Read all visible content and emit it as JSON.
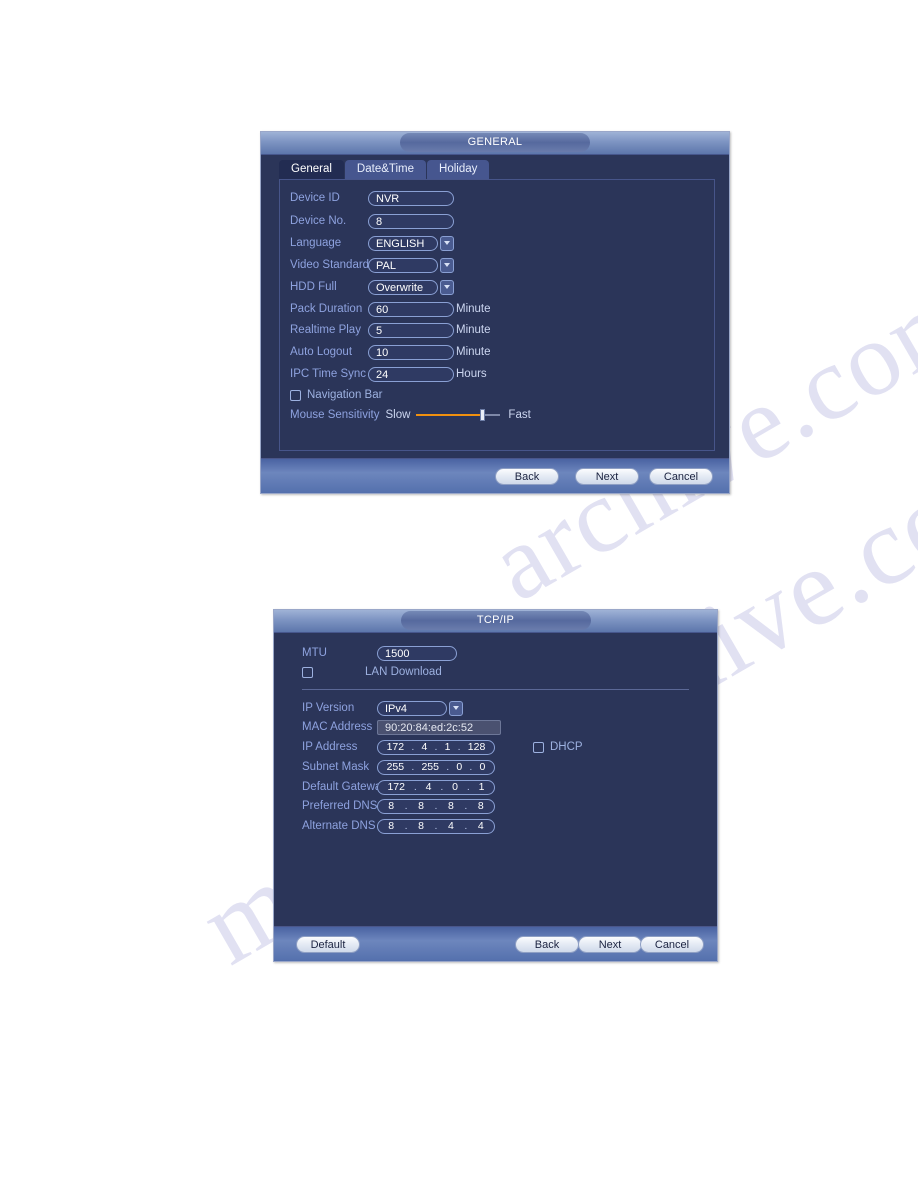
{
  "watermark": {
    "line1": "manualsarchive.com",
    "line2": "archive.com"
  },
  "general_dialog": {
    "title": "GENERAL",
    "tabs": [
      {
        "label": "General",
        "active": true
      },
      {
        "label": "Date&Time",
        "active": false
      },
      {
        "label": "Holiday",
        "active": false
      }
    ],
    "fields": {
      "device_id": {
        "label": "Device ID",
        "value": "NVR"
      },
      "device_no": {
        "label": "Device No.",
        "value": "8"
      },
      "language": {
        "label": "Language",
        "value": "ENGLISH"
      },
      "video_standard": {
        "label": "Video Standard",
        "value": "PAL"
      },
      "hdd_full": {
        "label": "HDD Full",
        "value": "Overwrite"
      },
      "pack_duration": {
        "label": "Pack Duration",
        "value": "60",
        "unit": "Minute"
      },
      "realtime_play": {
        "label": "Realtime Play",
        "value": "5",
        "unit": "Minute"
      },
      "auto_logout": {
        "label": "Auto Logout",
        "value": "10",
        "unit": "Minute"
      },
      "ipc_time_sync": {
        "label": "IPC Time Sync",
        "value": "24",
        "unit": "Hours"
      },
      "navigation_bar": {
        "label": "Navigation Bar",
        "checked": false
      },
      "mouse_sensitivity": {
        "label": "Mouse Sensitivity",
        "min_label": "Slow",
        "max_label": "Fast",
        "percent": 78
      }
    },
    "buttons": {
      "back": "Back",
      "next": "Next",
      "cancel": "Cancel"
    }
  },
  "tcpip_dialog": {
    "title": "TCP/IP",
    "fields": {
      "mtu": {
        "label": "MTU",
        "value": "1500"
      },
      "lan_download": {
        "label": "LAN Download",
        "checked": false
      },
      "ip_version": {
        "label": "IP Version",
        "value": "IPv4"
      },
      "mac_address": {
        "label": "MAC Address",
        "value": "90:20:84:ed:2c:52"
      },
      "ip_address": {
        "label": "IP Address",
        "octets": [
          "172",
          "4",
          "1",
          "128"
        ]
      },
      "subnet_mask": {
        "label": "Subnet Mask",
        "octets": [
          "255",
          "255",
          "0",
          "0"
        ]
      },
      "default_gateway": {
        "label": "Default Gateway",
        "octets": [
          "172",
          "4",
          "0",
          "1"
        ]
      },
      "preferred_dns": {
        "label": "Preferred DNS",
        "octets": [
          "8",
          "8",
          "8",
          "8"
        ]
      },
      "alternate_dns": {
        "label": "Alternate DNS",
        "octets": [
          "8",
          "8",
          "4",
          "4"
        ]
      },
      "dhcp": {
        "label": "DHCP",
        "checked": false
      }
    },
    "buttons": {
      "default": "Default",
      "back": "Back",
      "next": "Next",
      "cancel": "Cancel"
    }
  },
  "colors": {
    "dialog_bg": "#2b3559",
    "label_blue": "#8ea2df",
    "accent_orange": "#f0900f",
    "title_bar": "#7d94c2"
  }
}
